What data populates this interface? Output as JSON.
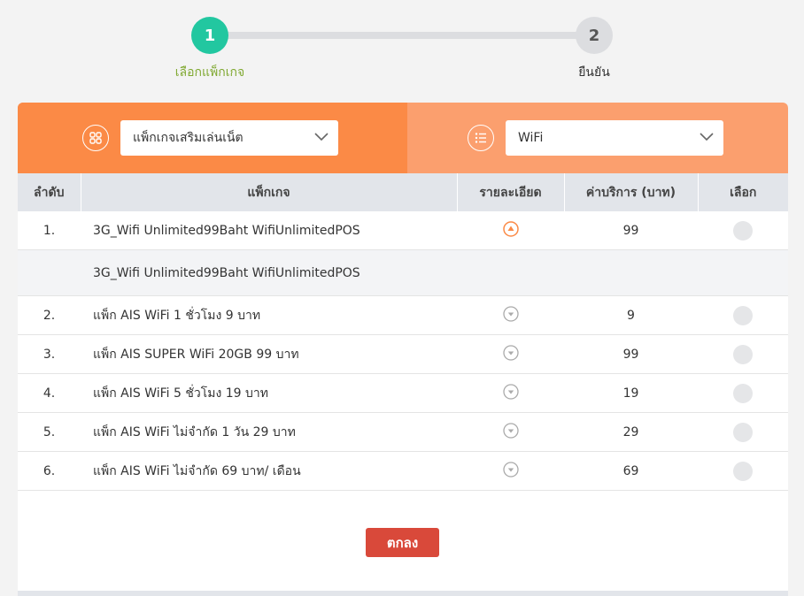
{
  "stepper": {
    "steps": [
      {
        "number": "1",
        "label": "เลือกแพ็กเกจ"
      },
      {
        "number": "2",
        "label": "ยืนยัน"
      }
    ]
  },
  "filters": {
    "category_select": {
      "value": "แพ็กเกจเสริมเล่นเน็ต",
      "icon": "grid-icon"
    },
    "type_select": {
      "value": "WiFi",
      "icon": "list-icon"
    }
  },
  "colors": {
    "accent_green": "#22c7a0",
    "orange_left": "#fb8a46",
    "orange_right": "#fb9f6e",
    "button_red": "#d9493a"
  },
  "table": {
    "headers": {
      "index": "ลำดับ",
      "package": "แพ็กเกจ",
      "details": "รายละเอียด",
      "price": "ค่าบริการ (บาท)",
      "select": "เลือก"
    },
    "rows": [
      {
        "index": "1.",
        "package": "3G_Wifi Unlimited99Baht WifiUnlimitedPOS",
        "price": "99",
        "expanded": true,
        "detail": "3G_Wifi Unlimited99Baht WifiUnlimitedPOS"
      },
      {
        "index": "2.",
        "package": "แพ็ก AIS WiFi 1 ชั่วโมง 9 บาท",
        "price": "9"
      },
      {
        "index": "3.",
        "package": "แพ็ก AIS SUPER WiFi 20GB 99 บาท",
        "price": "99"
      },
      {
        "index": "4.",
        "package": "แพ็ก AIS WiFi 5 ชั่วโมง 19 บาท",
        "price": "19"
      },
      {
        "index": "5.",
        "package": "แพ็ก AIS WiFi ไม่จำกัด 1 วัน 29 บาท",
        "price": "29"
      },
      {
        "index": "6.",
        "package": "แพ็ก AIS WiFi ไม่จำกัด 69 บาท/ เดือน",
        "price": "69"
      }
    ]
  },
  "actions": {
    "ok_label": "ตกลง"
  }
}
